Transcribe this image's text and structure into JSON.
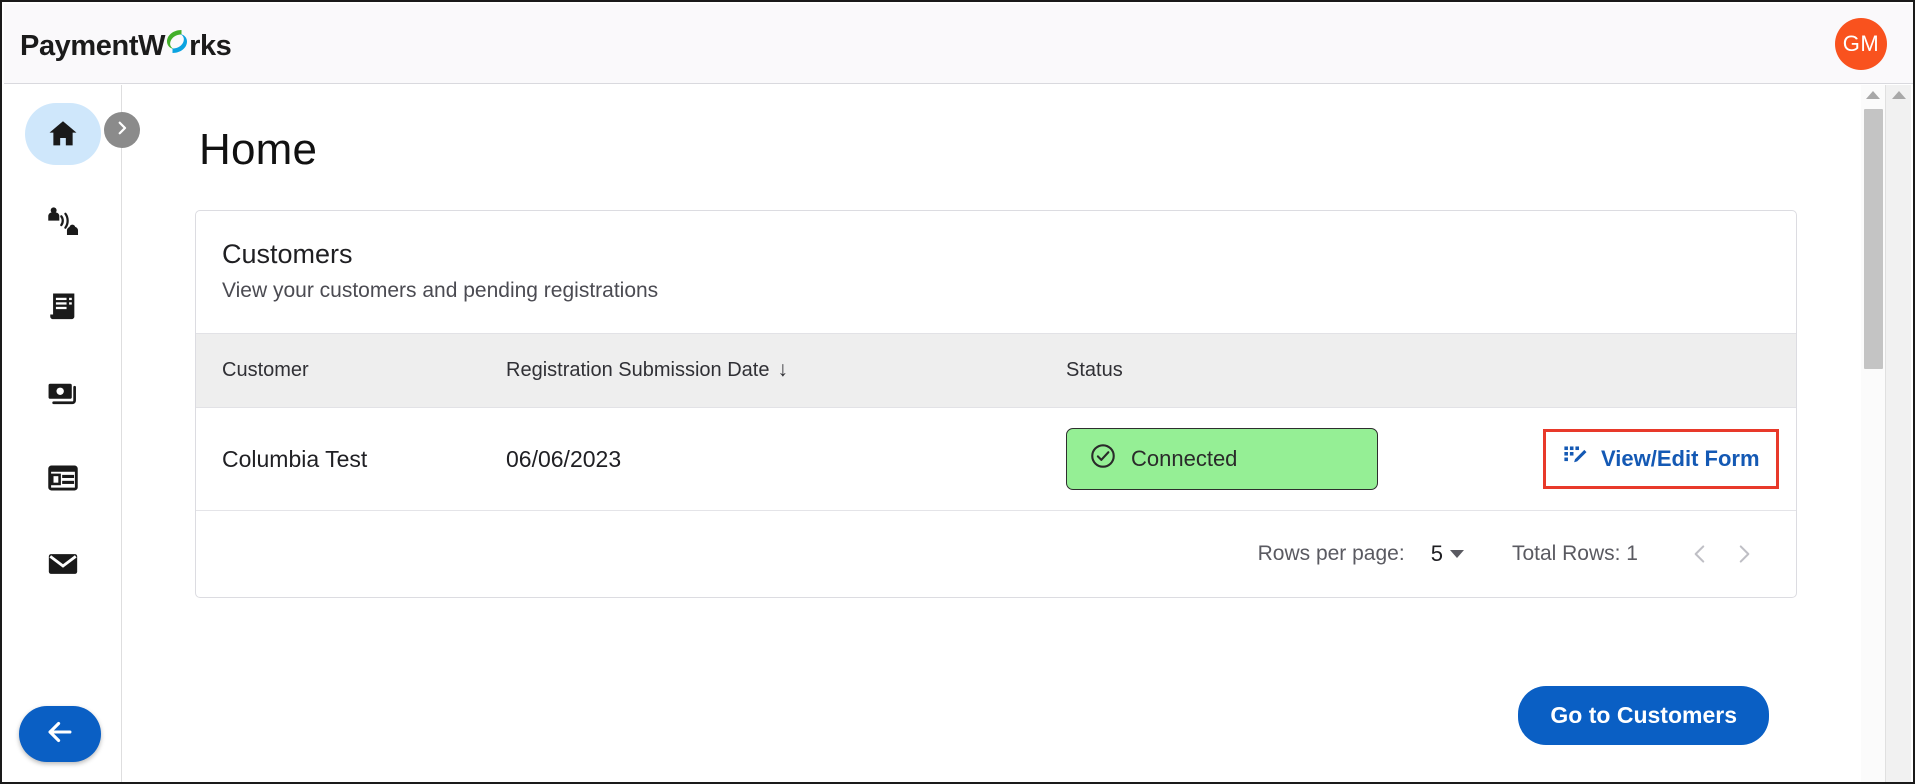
{
  "brand": {
    "name_part1": "PaymentW",
    "name_part2": "rks",
    "swirl_green": "#43b02a",
    "swirl_blue": "#0aa3e0"
  },
  "topbar": {
    "avatar_initials": "GM",
    "avatar_color": "#f9521e"
  },
  "sidebar": {
    "toggle_icon": "chevron-right-icon",
    "back_icon": "arrow-left-icon",
    "items": [
      {
        "label": "Home",
        "icon": "home-icon",
        "active": true
      },
      {
        "label": "Connections",
        "icon": "connections-icon",
        "active": false
      },
      {
        "label": "Invoices",
        "icon": "receipt-icon",
        "active": false
      },
      {
        "label": "Payments",
        "icon": "money-icon",
        "active": false
      },
      {
        "label": "Remittance",
        "icon": "table-icon",
        "active": false
      },
      {
        "label": "Messages",
        "icon": "envelope-icon",
        "active": false
      }
    ]
  },
  "page": {
    "title": "Home"
  },
  "card": {
    "title": "Customers",
    "subtitle": "View your customers and pending registrations",
    "columns": [
      {
        "label": "Customer",
        "sorted": false
      },
      {
        "label": "Registration Submission Date",
        "sorted": true,
        "sort_arrow": "↓"
      },
      {
        "label": "Status",
        "sorted": false
      },
      {
        "label": "",
        "sorted": false
      }
    ],
    "rows": [
      {
        "customer": "Columbia Test",
        "date": "06/06/2023",
        "status": "Connected",
        "status_icon": "check-circle-icon",
        "status_bg": "#95ef95",
        "action_label": "View/Edit Form",
        "action_icon": "form-edit-icon",
        "action_color": "#1459b4",
        "highlighted": true,
        "highlight_color": "#e8392a"
      }
    ],
    "pagination": {
      "rows_per_page_label": "Rows per page:",
      "rows_per_page_value": "5",
      "total_rows_label": "Total Rows: 1",
      "prev_icon": "chevron-left-icon",
      "next_icon": "chevron-right-icon"
    }
  },
  "actions": {
    "go_to_customers": "Go to Customers",
    "go_to_customers_color": "#0a5fc4"
  }
}
